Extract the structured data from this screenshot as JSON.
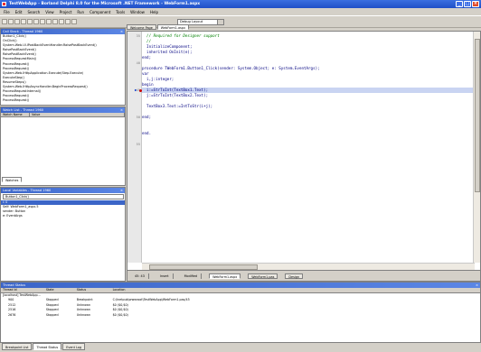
{
  "window": {
    "title": "TestWebApp - Borland Delphi 8.0 for the Microsoft .NET Framework - WebForm1.aspx"
  },
  "menu": [
    "File",
    "Edit",
    "Search",
    "View",
    "Project",
    "Run",
    "Component",
    "Tools",
    "Window",
    "Help"
  ],
  "toolbar": {
    "layout_combo": "Debug Layout"
  },
  "call_stack": {
    "title": "Call Stack - Thread 1960",
    "items": [
      "Button1_Click()",
      "OnClick()",
      "System.Web.UI.IPostBackEventHandler.RaisePostBackEvent()",
      "RaisePostBackEvent()",
      "RaisePostBackEvent()",
      "ProcessRequestMain()",
      "ProcessRequest()",
      "ProcessRequest()",
      "System.Web.IHttpApplication.Execute(Step.Execute)",
      "ExecuteStep()",
      "ResumeSteps()",
      "System.Web.IHttpAsyncHandler.BeginProcessRequest()",
      "ProcessRequestInternal()",
      "ProcessRequest()",
      "ProcessRequest()"
    ]
  },
  "watch": {
    "title": "Watch List - Thread 1960",
    "columns": [
      "Watch Name",
      "Value"
    ],
    "tab": "Watches"
  },
  "local_vars": {
    "title": "Local Variables - Thread 1960",
    "combo": "Button1_Click()",
    "items": [
      "i: 0",
      "Self: WebForm1_aspx.5",
      "sender: Button",
      "e: EventArgs"
    ]
  },
  "editor": {
    "tabs": [
      "Welcome Page",
      "WebForm1.aspx"
    ],
    "lines": [
      {
        "num": "35",
        "text": "  // Required for Designer support",
        "comment": true
      },
      {
        "num": "",
        "text": "  //",
        "comment": true
      },
      {
        "num": "",
        "text": "  InitializeComponent;"
      },
      {
        "num": "",
        "text": "  inherited OnInit(e);"
      },
      {
        "num": "",
        "text": "end;"
      },
      {
        "num": "40",
        "text": ""
      },
      {
        "num": "",
        "text": "procedure TWebForm1.Button1_Click(sender: System.Object; e: System.EventArgs);"
      },
      {
        "num": "",
        "text": "var"
      },
      {
        "num": "",
        "text": "  i,j:integer;"
      },
      {
        "num": "",
        "text": "begin"
      },
      {
        "num": "45",
        "text": "  i:=StrToInt(TextBox1.Text);",
        "highlight": true
      },
      {
        "num": "",
        "text": "  j:=StrToInt(TextBox2.Text);"
      },
      {
        "num": "",
        "text": ""
      },
      {
        "num": "",
        "text": "  TextBox3.Text:=IntToStr(i+j);"
      },
      {
        "num": "",
        "text": ""
      },
      {
        "num": "50",
        "text": "end;"
      },
      {
        "num": "",
        "text": ""
      },
      {
        "num": "",
        "text": ""
      },
      {
        "num": "",
        "text": "end."
      },
      {
        "num": "",
        "text": ""
      },
      {
        "num": "55",
        "text": ""
      }
    ],
    "status": {
      "position": "45: 43",
      "mode": "Insert",
      "state": "Modified"
    },
    "bottom_tabs": [
      "WebForm1.aspx",
      "WebForm1.pas",
      "Design"
    ]
  },
  "thread_status": {
    "title": "Thread Status",
    "columns": [
      "Thread Id",
      "State",
      "Status",
      "Location"
    ],
    "process": "[localhost] TestWebApp...",
    "rows": [
      {
        "id": "900",
        "state": "Stopped",
        "status": "Breakpoint",
        "location": "C:\\Inetpub\\wwwroot\\TestWebApp\\WebForm1.pas/45"
      },
      {
        "id": "2512",
        "state": "Stopped",
        "status": "Unknown",
        "location": "$0 ($0,$0)"
      },
      {
        "id": "2516",
        "state": "Stopped",
        "status": "Unknown",
        "location": "$0 ($0,$0)"
      },
      {
        "id": "2676",
        "state": "Stopped",
        "status": "Unknown",
        "location": "$0 ($0,$0)"
      }
    ]
  },
  "footer_tabs": [
    "Breakpoint List",
    "Thread Status",
    "Event Log"
  ]
}
